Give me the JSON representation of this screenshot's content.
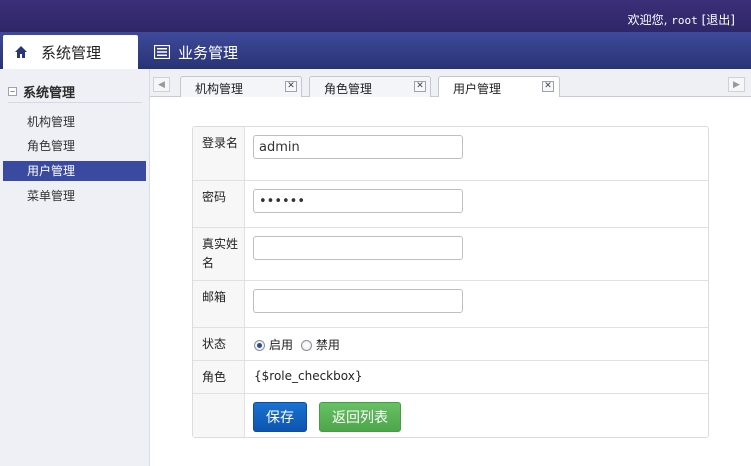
{
  "header": {
    "welcome_prefix": "欢迎您,",
    "username": "root",
    "logout": "[退出]"
  },
  "nav": {
    "tabs": [
      {
        "label": "系统管理",
        "icon": "home-icon",
        "active": true
      },
      {
        "label": "业务管理",
        "icon": "list-icon",
        "active": false
      }
    ]
  },
  "sidebar": {
    "group_title": "系统管理",
    "items": [
      {
        "label": "机构管理",
        "active": false
      },
      {
        "label": "角色管理",
        "active": false
      },
      {
        "label": "用户管理",
        "active": true
      },
      {
        "label": "菜单管理",
        "active": false
      }
    ]
  },
  "page_tabs": [
    {
      "label": "机构管理",
      "close": "✕",
      "active": false
    },
    {
      "label": "角色管理",
      "close": "✕",
      "active": false
    },
    {
      "label": "用户管理",
      "close": "✕",
      "active": true
    }
  ],
  "form": {
    "username": {
      "label": "登录名",
      "value": "admin"
    },
    "password": {
      "label": "密码",
      "value": "••••••"
    },
    "realname": {
      "label": "真实姓名",
      "value": ""
    },
    "email": {
      "label": "邮箱",
      "value": ""
    },
    "status": {
      "label": "状态",
      "options": [
        "启用",
        "禁用"
      ],
      "selected": "启用"
    },
    "role": {
      "label": "角色",
      "value": "{$role_checkbox}"
    },
    "save_label": "保存",
    "back_label": "返回列表"
  },
  "colors": {
    "topbar": "#3b2f78",
    "navbar": "#323d88",
    "sidebar_active": "#3a4aa0",
    "save_button": "#1266c4",
    "back_button": "#5ab557"
  }
}
